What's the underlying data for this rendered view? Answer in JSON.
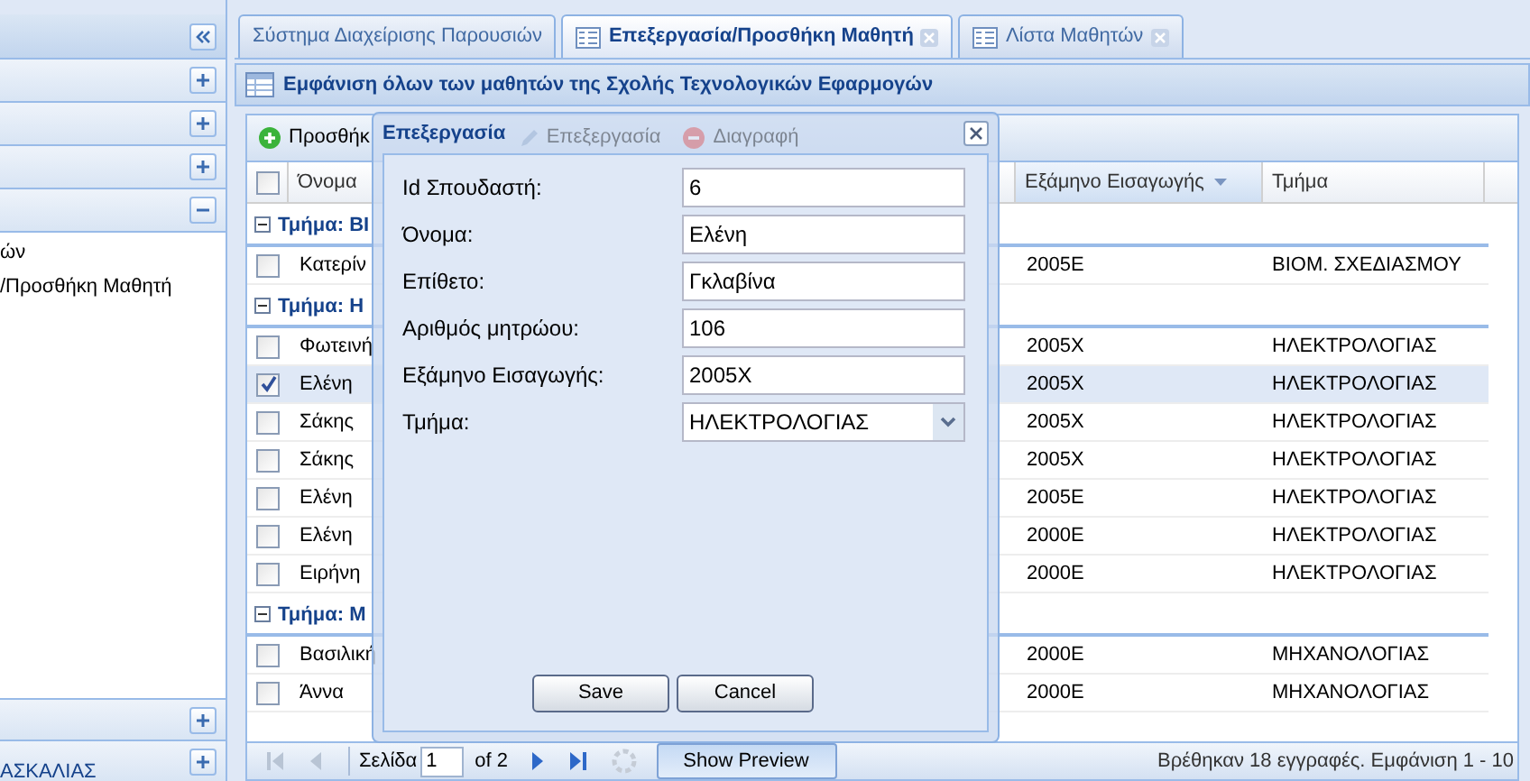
{
  "sidebar": {
    "top_panels": [
      {
        "expanded": false
      },
      {
        "expanded": false
      },
      {
        "expanded": false
      },
      {
        "expanded": true
      }
    ],
    "tree_items": [
      {
        "label": "ών"
      },
      {
        "label": "/Προσθήκη Μαθητή"
      }
    ],
    "bottom_panels": [
      {
        "expanded": false
      },
      {
        "title": "ΑΣΚΑΛΙΑΣ",
        "expanded": false
      }
    ]
  },
  "tabs": [
    {
      "label": "Σύστημα Διαχείρισης Παρουσιών",
      "selected": false,
      "icon": false,
      "closable": false
    },
    {
      "label": "Επεξεργασία/Προσθήκη Μαθητή",
      "selected": true,
      "icon": true,
      "closable": true
    },
    {
      "label": "Λίστα Μαθητών",
      "selected": false,
      "icon": true,
      "closable": true
    }
  ],
  "panel": {
    "title": "Εμφάνιση όλων των μαθητών της Σχολής Τεχνολογικών Εφαρμογών"
  },
  "toolbar": [
    {
      "kind": "add",
      "label": "Προσθήκ",
      "disabled": false
    },
    {
      "kind": "edit",
      "label": "Επεξεργασία",
      "disabled": true
    },
    {
      "kind": "delete",
      "label": "Διαγραφή",
      "disabled": true
    }
  ],
  "grid": {
    "select_all_checked": false,
    "columns": [
      {
        "label": "Όνομα",
        "sorted_descending": false
      },
      {
        "label": "Εξάμηνο Εισαγωγής",
        "sorted_descending": true
      },
      {
        "label": "Τμήμα",
        "sorted_descending": false
      }
    ],
    "groups": [
      {
        "label": "Τμήμα: ΒΙ",
        "expanded": true,
        "rows": [
          {
            "name": "Κατερίν",
            "exam": "2005Ε",
            "dept": "ΒΙΟΜ. ΣΧΕΔΙΑΣΜΟΥ",
            "checked": false,
            "selected": false
          }
        ]
      },
      {
        "label": "Τμήμα: Η",
        "expanded": true,
        "rows": [
          {
            "name": "Φωτεινή",
            "exam": "2005Χ",
            "dept": "ΗΛΕΚΤΡΟΛΟΓΙΑΣ",
            "checked": false,
            "selected": false
          },
          {
            "name": "Ελένη",
            "exam": "2005Χ",
            "dept": "ΗΛΕΚΤΡΟΛΟΓΙΑΣ",
            "checked": true,
            "selected": true
          },
          {
            "name": "Σάκης",
            "exam": "2005Χ",
            "dept": "ΗΛΕΚΤΡΟΛΟΓΙΑΣ",
            "checked": false,
            "selected": false
          },
          {
            "name": "Σάκης",
            "exam": "2005Χ",
            "dept": "ΗΛΕΚΤΡΟΛΟΓΙΑΣ",
            "checked": false,
            "selected": false
          },
          {
            "name": "Ελένη",
            "exam": "2005Ε",
            "dept": "ΗΛΕΚΤΡΟΛΟΓΙΑΣ",
            "checked": false,
            "selected": false
          },
          {
            "name": "Ελένη",
            "exam": "2000Ε",
            "dept": "ΗΛΕΚΤΡΟΛΟΓΙΑΣ",
            "checked": false,
            "selected": false
          },
          {
            "name": "Ειρήνη",
            "exam": "2000Ε",
            "dept": "ΗΛΕΚΤΡΟΛΟΓΙΑΣ",
            "checked": false,
            "selected": false
          }
        ]
      },
      {
        "label": "Τμήμα: Μ",
        "expanded": true,
        "rows": [
          {
            "name": "Βασιλική",
            "exam": "2000Ε",
            "dept": "ΜΗΧΑΝΟΛΟΓΙΑΣ",
            "checked": false,
            "selected": false
          },
          {
            "name": "Άννα",
            "exam": "2000Ε",
            "dept": "ΜΗΧΑΝΟΛΟΓΙΑΣ",
            "checked": false,
            "selected": false
          }
        ]
      }
    ]
  },
  "paging": {
    "nav": [
      {
        "kind": "first",
        "disabled": true
      },
      {
        "kind": "prev",
        "disabled": true
      }
    ],
    "nav_after": [
      {
        "kind": "next",
        "disabled": false
      },
      {
        "kind": "last",
        "disabled": false
      }
    ],
    "page_label": "Σελίδα",
    "page": "1",
    "of": "of 2",
    "preview_button": {
      "label": "Show Preview",
      "pressed": true
    },
    "status": "Βρέθηκαν 18 εγγραφές. Εμφάνιση 1 - 10"
  },
  "dialog": {
    "title": "Επεξεργασία",
    "fields": [
      {
        "kind": "text",
        "label": "Id Σπουδαστή:",
        "value": "6"
      },
      {
        "kind": "text",
        "label": "Όνομα:",
        "value": "Ελένη"
      },
      {
        "kind": "text",
        "label": "Επίθετο:",
        "value": "Γκλαβίνα"
      },
      {
        "kind": "text",
        "label": "Αριθμός μητρώου:",
        "value": "106"
      },
      {
        "kind": "text",
        "label": "Εξάμηνο Εισαγωγής:",
        "value": "2005Χ"
      },
      {
        "kind": "select",
        "label": "Τμήμα:",
        "value": "ΗΛΕΚΤΡΟΛΟΓΙΑΣ"
      }
    ],
    "buttons": [
      "Save",
      "Cancel"
    ]
  }
}
